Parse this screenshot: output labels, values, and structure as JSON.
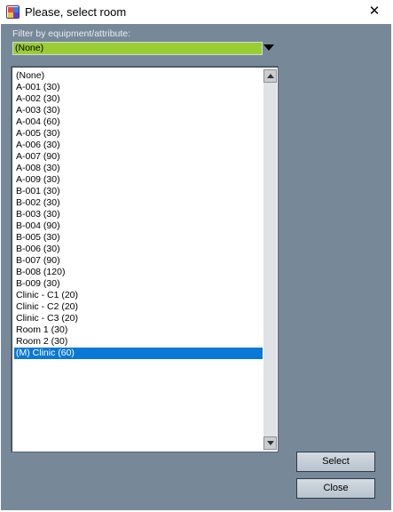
{
  "window": {
    "title": "Please, select room",
    "close_glyph": "✕"
  },
  "filter": {
    "label": "Filter by equipment/attribute:",
    "selected": "(None)"
  },
  "rooms": {
    "items": [
      "(None)",
      "A-001 (30)",
      "A-002 (30)",
      "A-003 (30)",
      "A-004 (60)",
      "A-005 (30)",
      "A-006 (30)",
      "A-007 (90)",
      "A-008 (30)",
      "A-009 (30)",
      "B-001 (30)",
      "B-002 (30)",
      "B-003 (30)",
      "B-004 (90)",
      "B-005 (30)",
      "B-006 (30)",
      "B-007 (90)",
      "B-008 (120)",
      "B-009 (30)",
      "Clinic - C1 (20)",
      "Clinic - C2 (20)",
      "Clinic - C3 (20)",
      "Room 1 (30)",
      "Room 2 (30)",
      "(M) Clinic (60)"
    ],
    "selected_index": 24
  },
  "buttons": {
    "select": "Select",
    "close": "Close"
  },
  "colors": {
    "background": "#778899",
    "filter_combo": "#9acd32",
    "selection": "#0a78d7"
  }
}
